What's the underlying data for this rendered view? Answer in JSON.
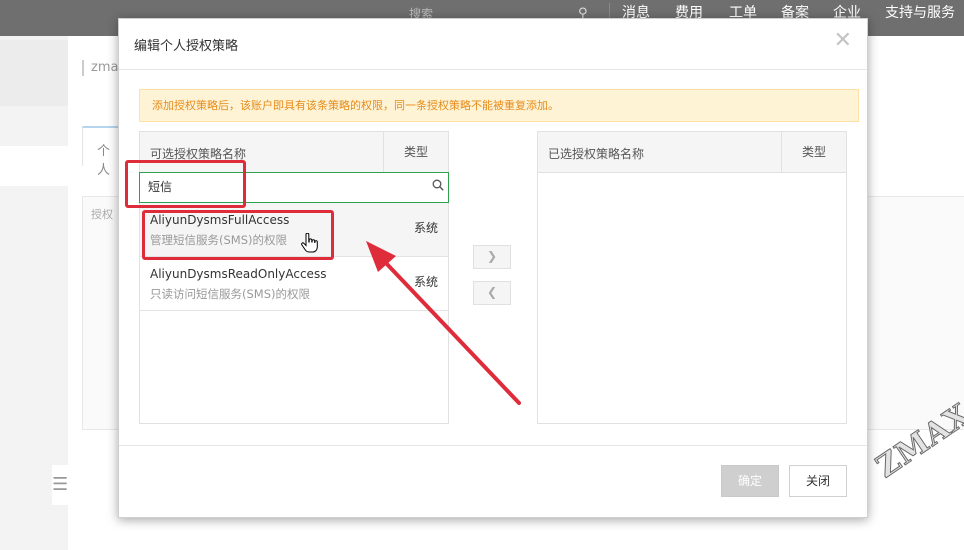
{
  "topbar": {
    "search_placeholder": "搜索",
    "nav": [
      "消息",
      "费用",
      "工单",
      "备案",
      "企业",
      "支持与服务"
    ]
  },
  "background": {
    "breadcrumb": "zma",
    "tab": "个人",
    "panel_label": "授权"
  },
  "dialog": {
    "title": "编辑个人授权策略",
    "notice": "添加授权策略后，该账户即具有该条策略的权限，同一条授权策略不能被重复添加。",
    "left_panel": {
      "header_name": "可选授权策略名称",
      "header_type": "类型",
      "search_value": "短信",
      "items": [
        {
          "name": "AliyunDysmsFullAccess",
          "desc": "管理短信服务(SMS)的权限",
          "type": "系统"
        },
        {
          "name": "AliyunDysmsReadOnlyAccess",
          "desc": "只读访问短信服务(SMS)的权限",
          "type": "系统"
        }
      ]
    },
    "right_panel": {
      "header_name": "已选授权策略名称",
      "header_type": "类型"
    },
    "buttons": {
      "confirm": "确定",
      "close": "关闭"
    }
  },
  "watermark": "ZMAX",
  "colors": {
    "annotation": "#de2c3b",
    "search_border": "#2da14c",
    "notice_bg": "#fff3d6",
    "notice_text": "#e68c1a"
  }
}
